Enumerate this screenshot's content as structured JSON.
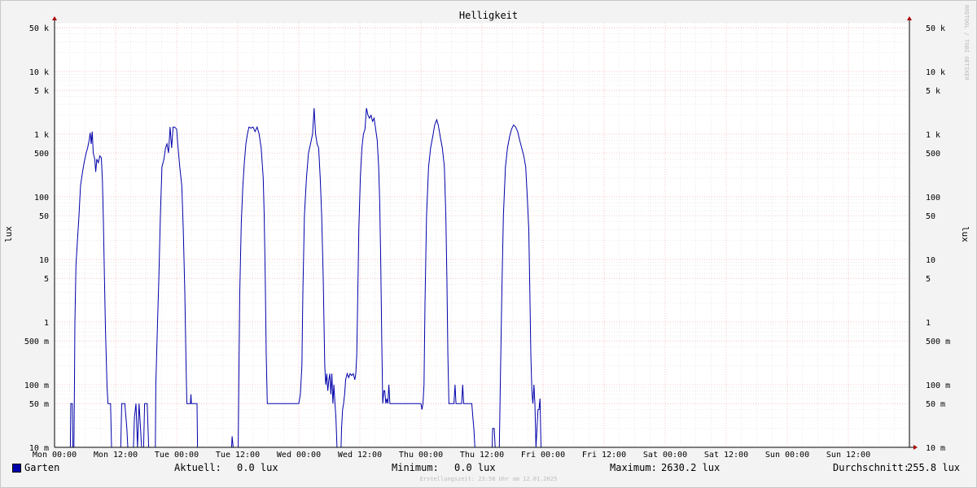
{
  "chart_data": {
    "type": "line",
    "title": "Helligkeit",
    "ylabel": "lux",
    "y_scale": "log",
    "ylim_lux": [
      0.01,
      60000
    ],
    "y_ticks": [
      {
        "value": 50000,
        "label": "50 k"
      },
      {
        "value": 10000,
        "label": "10 k"
      },
      {
        "value": 5000,
        "label": "5 k"
      },
      {
        "value": 1000,
        "label": "1 k"
      },
      {
        "value": 500,
        "label": "500"
      },
      {
        "value": 100,
        "label": "100"
      },
      {
        "value": 50,
        "label": "50"
      },
      {
        "value": 10,
        "label": "10"
      },
      {
        "value": 5,
        "label": "5"
      },
      {
        "value": 1,
        "label": "1"
      },
      {
        "value": 0.5,
        "label": "500 m"
      },
      {
        "value": 0.1,
        "label": "100 m"
      },
      {
        "value": 0.05,
        "label": "50 m"
      },
      {
        "value": 0.01,
        "label": "10 m"
      }
    ],
    "x_range_hours": [
      0,
      168
    ],
    "x_ticks": [
      {
        "hour": 0,
        "label": "Mon 00:00"
      },
      {
        "hour": 12,
        "label": "Mon 12:00"
      },
      {
        "hour": 24,
        "label": "Tue 00:00"
      },
      {
        "hour": 36,
        "label": "Tue 12:00"
      },
      {
        "hour": 48,
        "label": "Wed 00:00"
      },
      {
        "hour": 60,
        "label": "Wed 12:00"
      },
      {
        "hour": 72,
        "label": "Thu 00:00"
      },
      {
        "hour": 84,
        "label": "Thu 12:00"
      },
      {
        "hour": 96,
        "label": "Fri 00:00"
      },
      {
        "hour": 108,
        "label": "Fri 12:00"
      },
      {
        "hour": 120,
        "label": "Sat 00:00"
      },
      {
        "hour": 132,
        "label": "Sat 12:00"
      },
      {
        "hour": 144,
        "label": "Sun 00:00"
      },
      {
        "hour": 156,
        "label": "Sun 12:00"
      }
    ],
    "series": [
      {
        "name": "Garten",
        "color": "#0000aa",
        "points": [
          [
            0,
            0.01
          ],
          [
            3.1,
            0.01
          ],
          [
            3.2,
            0.05
          ],
          [
            3.5,
            0.05
          ],
          [
            3.6,
            0.01
          ],
          [
            3.8,
            0.01
          ],
          [
            3.9,
            0.08
          ],
          [
            4.0,
            1
          ],
          [
            4.2,
            8
          ],
          [
            4.5,
            20
          ],
          [
            4.8,
            50
          ],
          [
            5.1,
            150
          ],
          [
            5.5,
            250
          ],
          [
            5.8,
            350
          ],
          [
            6.2,
            500
          ],
          [
            6.5,
            600
          ],
          [
            6.8,
            800
          ],
          [
            7.0,
            1050
          ],
          [
            7.2,
            700
          ],
          [
            7.4,
            1100
          ],
          [
            7.6,
            500
          ],
          [
            7.9,
            400
          ],
          [
            8.1,
            250
          ],
          [
            8.3,
            400
          ],
          [
            8.6,
            350
          ],
          [
            8.9,
            450
          ],
          [
            9.2,
            420
          ],
          [
            9.4,
            180
          ],
          [
            9.6,
            40
          ],
          [
            9.8,
            5
          ],
          [
            10.0,
            0.8
          ],
          [
            10.3,
            0.1
          ],
          [
            10.5,
            0.05
          ],
          [
            11.0,
            0.05
          ],
          [
            11.2,
            0.01
          ],
          [
            13.0,
            0.01
          ],
          [
            13.2,
            0.05
          ],
          [
            13.8,
            0.05
          ],
          [
            14.2,
            0.02
          ],
          [
            14.4,
            0.01
          ],
          [
            15.5,
            0.01
          ],
          [
            15.7,
            0.03
          ],
          [
            16.0,
            0.05
          ],
          [
            16.3,
            0.01
          ],
          [
            16.6,
            0.05
          ],
          [
            16.9,
            0.02
          ],
          [
            17.1,
            0.01
          ],
          [
            17.5,
            0.01
          ],
          [
            17.7,
            0.05
          ],
          [
            18.2,
            0.05
          ],
          [
            18.5,
            0.01
          ],
          [
            19.8,
            0.01
          ],
          [
            19.9,
            0.1
          ],
          [
            20.2,
            0.8
          ],
          [
            20.5,
            5
          ],
          [
            20.8,
            50
          ],
          [
            21.1,
            300
          ],
          [
            21.5,
            400
          ],
          [
            21.8,
            600
          ],
          [
            22.1,
            700
          ],
          [
            22.4,
            500
          ],
          [
            22.7,
            1300
          ],
          [
            23.0,
            600
          ],
          [
            23.3,
            1300
          ],
          [
            23.6,
            1300
          ],
          [
            24.0,
            1200
          ],
          [
            24.2,
            700
          ],
          [
            24.6,
            300
          ],
          [
            25.0,
            150
          ],
          [
            25.3,
            30
          ],
          [
            25.6,
            3
          ],
          [
            25.8,
            0.3
          ],
          [
            26.0,
            0.05
          ],
          [
            26.7,
            0.05
          ],
          [
            26.8,
            0.07
          ],
          [
            26.9,
            0.05
          ],
          [
            28.0,
            0.05
          ],
          [
            28.1,
            0.01
          ],
          [
            34.8,
            0.01
          ],
          [
            34.9,
            0.015
          ],
          [
            35.1,
            0.01
          ],
          [
            36.1,
            0.01
          ],
          [
            36.2,
            0.1
          ],
          [
            36.4,
            3
          ],
          [
            36.7,
            40
          ],
          [
            37.0,
            150
          ],
          [
            37.3,
            350
          ],
          [
            37.6,
            700
          ],
          [
            37.9,
            1000
          ],
          [
            38.2,
            1300
          ],
          [
            38.6,
            1250
          ],
          [
            39.0,
            1300
          ],
          [
            39.4,
            1100
          ],
          [
            39.8,
            1300
          ],
          [
            40.2,
            1000
          ],
          [
            40.6,
            600
          ],
          [
            41.0,
            200
          ],
          [
            41.2,
            50
          ],
          [
            41.4,
            5
          ],
          [
            41.6,
            0.3
          ],
          [
            41.8,
            0.05
          ],
          [
            48.0,
            0.05
          ],
          [
            48.3,
            0.07
          ],
          [
            48.6,
            0.2
          ],
          [
            48.8,
            3
          ],
          [
            49.1,
            50
          ],
          [
            49.5,
            200
          ],
          [
            49.9,
            500
          ],
          [
            50.3,
            700
          ],
          [
            50.7,
            1000
          ],
          [
            51.0,
            2600
          ],
          [
            51.3,
            1000
          ],
          [
            51.6,
            700
          ],
          [
            51.9,
            600
          ],
          [
            52.2,
            200
          ],
          [
            52.5,
            50
          ],
          [
            52.8,
            5
          ],
          [
            53.1,
            0.2
          ],
          [
            53.3,
            0.1
          ],
          [
            53.5,
            0.15
          ],
          [
            53.7,
            0.08
          ],
          [
            53.9,
            0.12
          ],
          [
            54.1,
            0.15
          ],
          [
            54.3,
            0.07
          ],
          [
            54.5,
            0.15
          ],
          [
            54.7,
            0.05
          ],
          [
            54.9,
            0.1
          ],
          [
            55.1,
            0.05
          ],
          [
            55.3,
            0.03
          ],
          [
            55.5,
            0.01
          ],
          [
            56.3,
            0.01
          ],
          [
            56.4,
            0.02
          ],
          [
            56.6,
            0.04
          ],
          [
            56.8,
            0.05
          ],
          [
            57.0,
            0.07
          ],
          [
            57.2,
            0.12
          ],
          [
            57.5,
            0.15
          ],
          [
            57.8,
            0.13
          ],
          [
            58.1,
            0.15
          ],
          [
            58.4,
            0.14
          ],
          [
            58.7,
            0.15
          ],
          [
            59.0,
            0.12
          ],
          [
            59.2,
            0.15
          ],
          [
            59.4,
            0.3
          ],
          [
            59.6,
            3
          ],
          [
            59.8,
            30
          ],
          [
            60.1,
            200
          ],
          [
            60.4,
            600
          ],
          [
            60.7,
            1000
          ],
          [
            61.0,
            1200
          ],
          [
            61.3,
            2600
          ],
          [
            61.6,
            2000
          ],
          [
            61.9,
            1800
          ],
          [
            62.2,
            2000
          ],
          [
            62.5,
            1600
          ],
          [
            62.8,
            1800
          ],
          [
            63.1,
            1200
          ],
          [
            63.4,
            800
          ],
          [
            63.7,
            300
          ],
          [
            63.9,
            80
          ],
          [
            64.1,
            10
          ],
          [
            64.3,
            0.5
          ],
          [
            64.5,
            0.05
          ],
          [
            64.7,
            0.08
          ],
          [
            64.9,
            0.08
          ],
          [
            65.1,
            0.05
          ],
          [
            65.3,
            0.06
          ],
          [
            65.5,
            0.05
          ],
          [
            65.7,
            0.1
          ],
          [
            65.9,
            0.05
          ],
          [
            72.0,
            0.05
          ],
          [
            72.2,
            0.04
          ],
          [
            72.4,
            0.05
          ],
          [
            72.6,
            0.1
          ],
          [
            72.8,
            2
          ],
          [
            73.1,
            50
          ],
          [
            73.5,
            300
          ],
          [
            73.9,
            600
          ],
          [
            74.3,
            900
          ],
          [
            74.7,
            1400
          ],
          [
            75.1,
            1700
          ],
          [
            75.4,
            1400
          ],
          [
            75.8,
            900
          ],
          [
            76.2,
            600
          ],
          [
            76.6,
            300
          ],
          [
            76.9,
            50
          ],
          [
            77.1,
            5
          ],
          [
            77.3,
            0.3
          ],
          [
            77.5,
            0.05
          ],
          [
            78.5,
            0.05
          ],
          [
            78.7,
            0.1
          ],
          [
            78.9,
            0.05
          ],
          [
            80.0,
            0.05
          ],
          [
            80.2,
            0.1
          ],
          [
            80.4,
            0.05
          ],
          [
            82.0,
            0.05
          ],
          [
            82.2,
            0.03
          ],
          [
            82.4,
            0.02
          ],
          [
            82.6,
            0.01
          ],
          [
            86.0,
            0.01
          ],
          [
            86.1,
            0.02
          ],
          [
            86.4,
            0.02
          ],
          [
            86.6,
            0.01
          ],
          [
            87.4,
            0.01
          ],
          [
            87.6,
            0.1
          ],
          [
            87.9,
            3
          ],
          [
            88.2,
            50
          ],
          [
            88.6,
            300
          ],
          [
            89.0,
            600
          ],
          [
            89.4,
            900
          ],
          [
            89.8,
            1200
          ],
          [
            90.2,
            1400
          ],
          [
            90.6,
            1300
          ],
          [
            91.0,
            1100
          ],
          [
            91.4,
            800
          ],
          [
            91.8,
            600
          ],
          [
            92.2,
            450
          ],
          [
            92.6,
            300
          ],
          [
            92.9,
            100
          ],
          [
            93.2,
            30
          ],
          [
            93.4,
            3
          ],
          [
            93.6,
            0.3
          ],
          [
            93.8,
            0.08
          ],
          [
            94.0,
            0.05
          ],
          [
            94.2,
            0.1
          ],
          [
            94.4,
            0.05
          ],
          [
            94.6,
            0.01
          ],
          [
            95.0,
            0.04
          ],
          [
            95.2,
            0.04
          ],
          [
            95.4,
            0.06
          ],
          [
            95.6,
            0.01
          ]
        ]
      }
    ],
    "legend": [
      {
        "name": "Garten",
        "color": "#0000aa"
      }
    ],
    "stats": {
      "current_label": "Aktuell:",
      "current_value": "0.0 lux",
      "min_label": "Minimum:",
      "min_value": "0.0 lux",
      "max_label": "Maximum:",
      "max_value": "2630.2 lux",
      "avg_label": "Durchschnitt:",
      "avg_value": "255.8 lux"
    },
    "footer": "Erstellungszeit: 23:58 Uhr am 12.01.2025",
    "watermark": "RRDTOOL / TOBI OETIKER"
  }
}
